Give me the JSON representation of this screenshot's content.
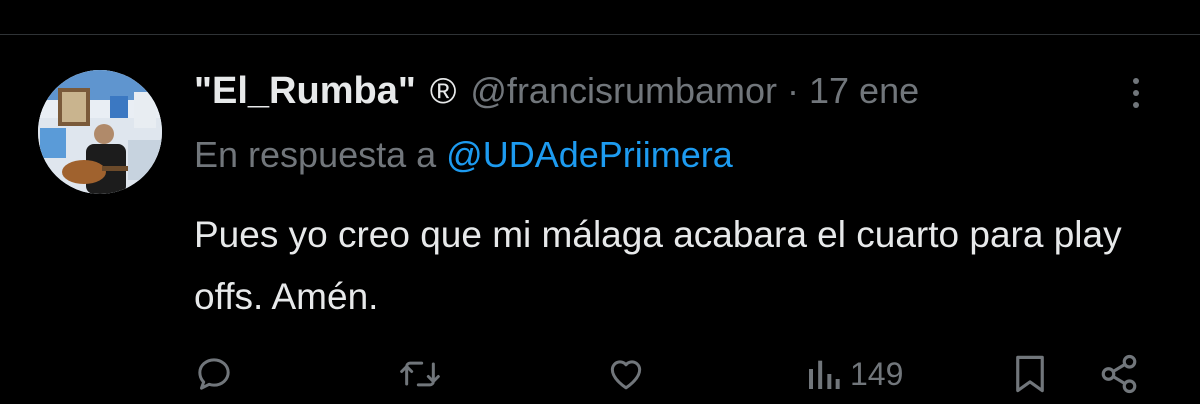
{
  "tweet": {
    "author": {
      "display_name": "\"El_Rumba\"",
      "badge": "®",
      "handle": "@francisrumbamor",
      "separator": "·",
      "time": "17 ene"
    },
    "reply": {
      "prefix": "En respuesta a",
      "mention": "@UDAdePriimera"
    },
    "text": "Pues yo creo que mi málaga acabara el cuarto para play offs. Amén.",
    "actions": {
      "views": "149"
    }
  },
  "icons": {
    "more": "more-vertical-icon",
    "reply": "reply-icon",
    "retweet": "retweet-icon",
    "like": "heart-icon",
    "views": "views-icon",
    "bookmark": "bookmark-icon",
    "share": "share-icon"
  },
  "colors": {
    "background": "#000000",
    "text_primary": "#e7e9ea",
    "text_secondary": "#71767b",
    "link": "#1d9bf0",
    "divider": "#2f3336"
  }
}
